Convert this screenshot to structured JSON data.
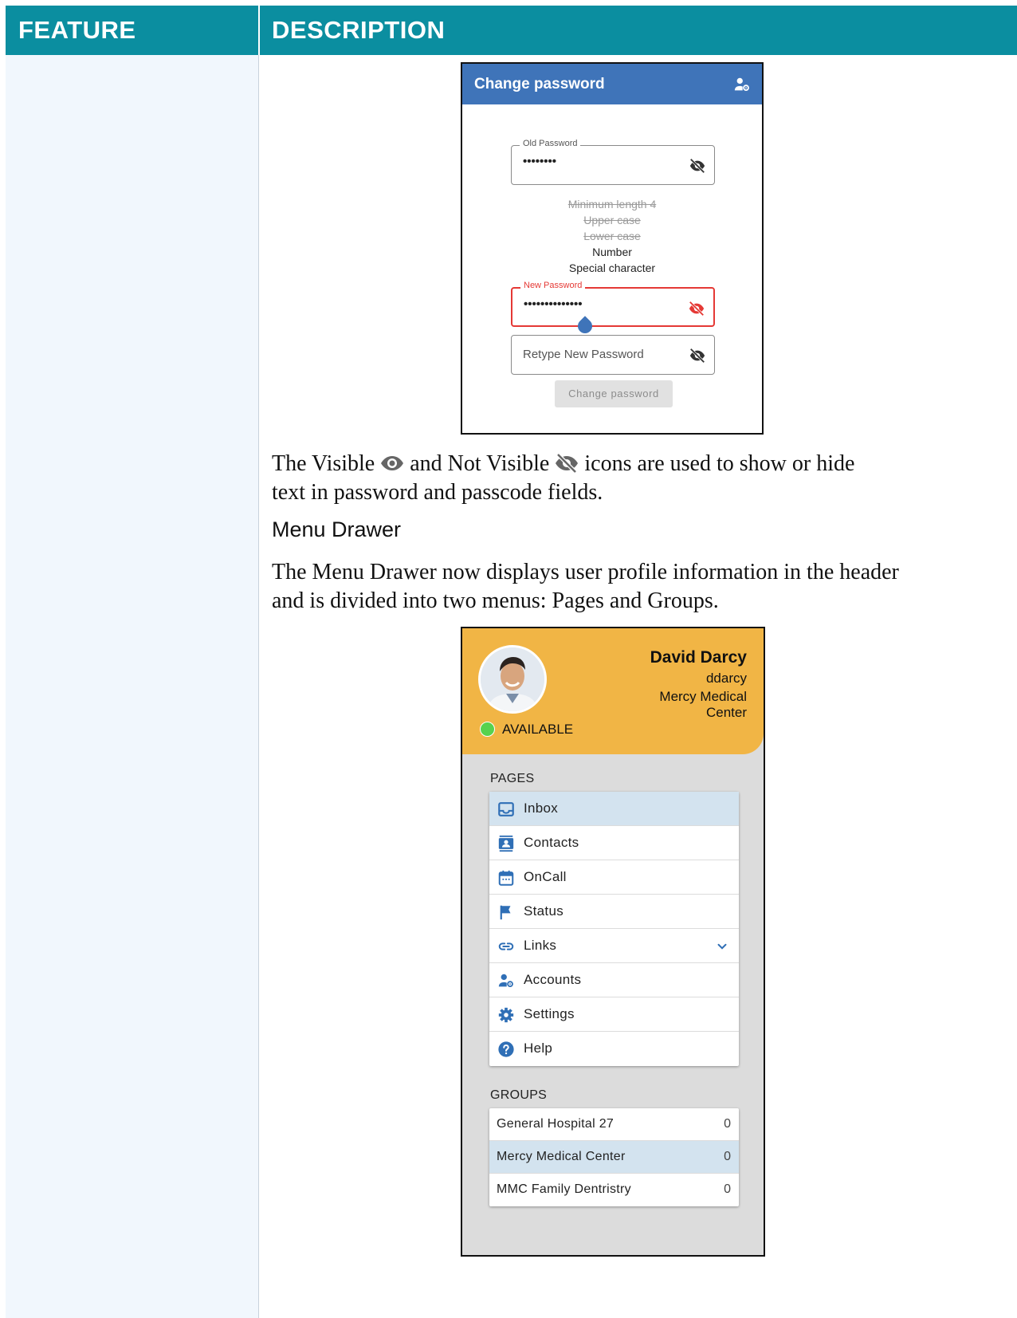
{
  "table": {
    "col_feature": "FEATURE",
    "col_description": "DESCRIPTION"
  },
  "change_password": {
    "title": "Change password",
    "old_password_label": "Old Password",
    "old_password_value": "••••••••",
    "rules": [
      {
        "text": "Minimum length 4",
        "met": true
      },
      {
        "text": "Upper case",
        "met": true
      },
      {
        "text": "Lower case",
        "met": true
      },
      {
        "text": "Number",
        "met": false
      },
      {
        "text": "Special character",
        "met": false
      }
    ],
    "new_password_label": "New Password",
    "new_password_value": "••••••••••••••",
    "retype_placeholder": "Retype New Password",
    "button_label": "Change password",
    "colors": {
      "appbar": "#3f74b9",
      "error": "#e53935"
    }
  },
  "para1": {
    "part1": "The Visible",
    "part2": "and Not Visible",
    "part3": "icons are used to show or hide",
    "line2": "text in password and passcode fields."
  },
  "subheading": "Menu Drawer",
  "para2": {
    "line1": "The Menu Drawer now displays user profile information in the header",
    "line2": "and is divided into two menus: Pages and Groups."
  },
  "menu_drawer": {
    "user_name": "David Darcy",
    "username": "ddarcy",
    "organization": "Mercy Medical Center",
    "status": "AVAILABLE",
    "pages_label": "PAGES",
    "pages": [
      {
        "label": "Inbox",
        "icon": "inbox-icon",
        "active": true
      },
      {
        "label": "Contacts",
        "icon": "contacts-icon",
        "active": false
      },
      {
        "label": "OnCall",
        "icon": "calendar-icon",
        "active": false
      },
      {
        "label": "Status",
        "icon": "flag-icon",
        "active": false
      },
      {
        "label": "Links",
        "icon": "link-icon",
        "active": false
      },
      {
        "label": "Accounts",
        "icon": "accounts-icon",
        "active": false
      },
      {
        "label": "Settings",
        "icon": "gear-icon",
        "active": false
      },
      {
        "label": "Help",
        "icon": "help-icon",
        "active": false
      }
    ],
    "groups_label": "GROUPS",
    "groups": [
      {
        "name": "General Hospital 27",
        "count": "0",
        "active": false
      },
      {
        "name": "Mercy Medical Center",
        "count": "0",
        "active": true
      },
      {
        "name": "MMC Family Dentristry",
        "count": "0",
        "active": false
      }
    ],
    "colors": {
      "header": "#f1b545",
      "accent": "#2f6fb6",
      "status": "#58d24e"
    }
  }
}
